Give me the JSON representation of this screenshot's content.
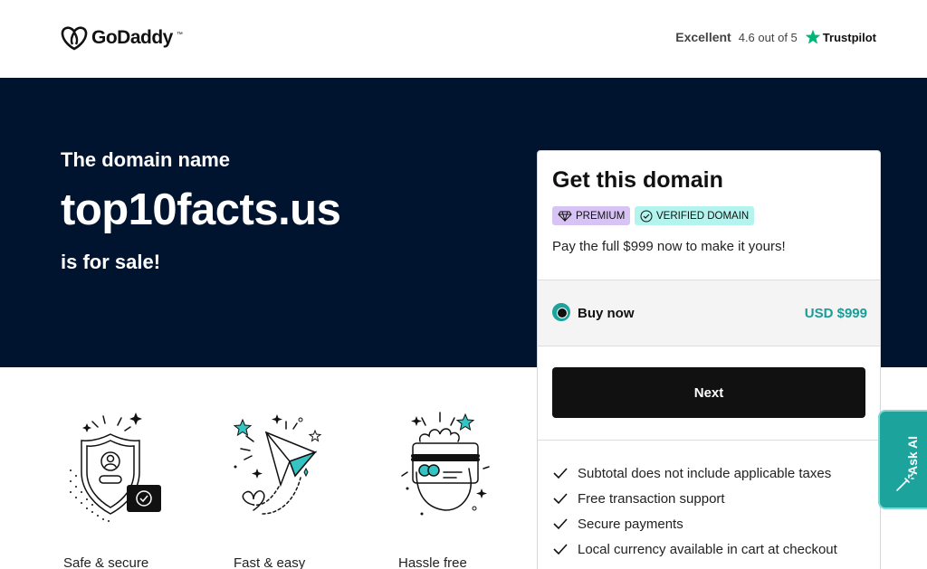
{
  "header": {
    "logo_text": "GoDaddy",
    "logo_tm": "™",
    "trustpilot": {
      "rating_word": "Excellent",
      "score_text": "4.6 out of 5",
      "brand": "Trustpilot",
      "star_color": "#00b67a"
    }
  },
  "hero": {
    "pre": "The domain name",
    "domain": "top10facts.us",
    "post": "is for sale!",
    "background": "#00132f"
  },
  "card": {
    "title": "Get this domain",
    "badge_premium": "PREMIUM",
    "badge_verified": "VERIFIED DOMAIN",
    "description": "Pay the full $999 now to make it yours!",
    "buy_label": "Buy now",
    "buy_price": "USD $999",
    "next_label": "Next",
    "accent": "#1ba39c",
    "features": [
      "Subtotal does not include applicable taxes",
      "Free transaction support",
      "Secure payments",
      "Local currency available in cart at checkout"
    ]
  },
  "features": [
    {
      "label": "Safe & secure",
      "icon": "shield-icon"
    },
    {
      "label": "Fast & easy",
      "icon": "paper-plane-icon"
    },
    {
      "label": "Hassle free",
      "icon": "card-hand-icon"
    }
  ],
  "ask_ai": {
    "label": "Ask AI",
    "icon": "magic-wand-icon"
  }
}
